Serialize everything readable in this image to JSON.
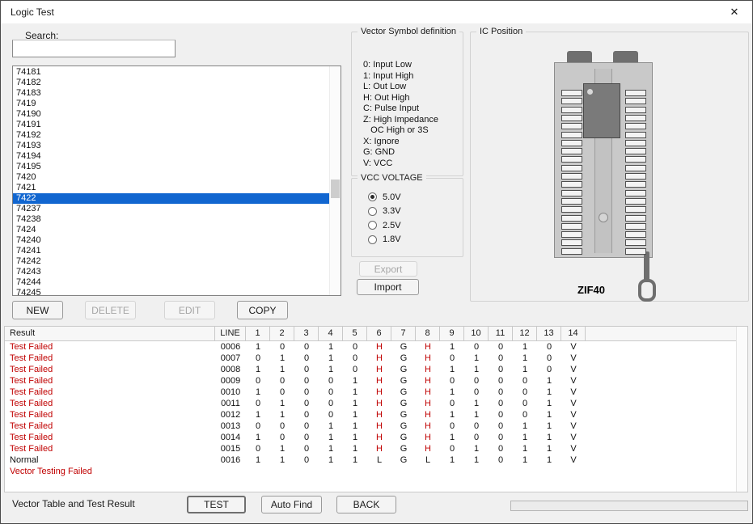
{
  "colors": {
    "selection": "#1166d0",
    "fail_red": "#c00000",
    "window_bg": "#f0f0f0"
  },
  "window": {
    "title": "Logic Test",
    "close_glyph": "✕"
  },
  "search": {
    "label": "Search:",
    "value": ""
  },
  "ic_list": {
    "items": [
      "74181",
      "74182",
      "74183",
      "7419",
      "74190",
      "74191",
      "74192",
      "74193",
      "74194",
      "74195",
      "7420",
      "7421",
      "7422",
      "74237",
      "74238",
      "7424",
      "74240",
      "74241",
      "74242",
      "74243",
      "74244",
      "74245"
    ],
    "selected": "7422"
  },
  "list_actions": {
    "new": "NEW",
    "delete": "DELETE",
    "edit": "EDIT",
    "copy": "COPY"
  },
  "vector_symbols": {
    "title": "Vector Symbol definition",
    "lines": [
      "0: Input Low",
      "1: Input High",
      "L: Out Low",
      "H: Out High",
      "C: Pulse Input",
      "Z: High Impedance",
      "   OC High or 3S",
      "X: Ignore",
      "G: GND",
      "V: VCC"
    ]
  },
  "vcc": {
    "title": "VCC VOLTAGE",
    "options": [
      {
        "label": "5.0V",
        "selected": true
      },
      {
        "label": "3.3V",
        "selected": false
      },
      {
        "label": "2.5V",
        "selected": false
      },
      {
        "label": "1.8V",
        "selected": false
      }
    ]
  },
  "transfer": {
    "export": "Export",
    "import": "Import"
  },
  "ic_position": {
    "title": "IC Position",
    "socket_label": "ZIF40"
  },
  "table": {
    "headers": [
      "Result",
      "LINE",
      "1",
      "2",
      "3",
      "4",
      "5",
      "6",
      "7",
      "8",
      "9",
      "10",
      "11",
      "12",
      "13",
      "14"
    ],
    "fail_symbol": "H",
    "rows": [
      {
        "result": "Test Failed",
        "status": "failed",
        "line": "0006",
        "pins": [
          "1",
          "0",
          "0",
          "1",
          "0",
          "H",
          "G",
          "H",
          "1",
          "0",
          "0",
          "1",
          "0",
          "V"
        ]
      },
      {
        "result": "Test Failed",
        "status": "failed",
        "line": "0007",
        "pins": [
          "0",
          "1",
          "0",
          "1",
          "0",
          "H",
          "G",
          "H",
          "0",
          "1",
          "0",
          "1",
          "0",
          "V"
        ]
      },
      {
        "result": "Test Failed",
        "status": "failed",
        "line": "0008",
        "pins": [
          "1",
          "1",
          "0",
          "1",
          "0",
          "H",
          "G",
          "H",
          "1",
          "1",
          "0",
          "1",
          "0",
          "V"
        ]
      },
      {
        "result": "Test Failed",
        "status": "failed",
        "line": "0009",
        "pins": [
          "0",
          "0",
          "0",
          "0",
          "1",
          "H",
          "G",
          "H",
          "0",
          "0",
          "0",
          "0",
          "1",
          "V"
        ]
      },
      {
        "result": "Test Failed",
        "status": "failed",
        "line": "0010",
        "pins": [
          "1",
          "0",
          "0",
          "0",
          "1",
          "H",
          "G",
          "H",
          "1",
          "0",
          "0",
          "0",
          "1",
          "V"
        ]
      },
      {
        "result": "Test Failed",
        "status": "failed",
        "line": "0011",
        "pins": [
          "0",
          "1",
          "0",
          "0",
          "1",
          "H",
          "G",
          "H",
          "0",
          "1",
          "0",
          "0",
          "1",
          "V"
        ]
      },
      {
        "result": "Test Failed",
        "status": "failed",
        "line": "0012",
        "pins": [
          "1",
          "1",
          "0",
          "0",
          "1",
          "H",
          "G",
          "H",
          "1",
          "1",
          "0",
          "0",
          "1",
          "V"
        ]
      },
      {
        "result": "Test Failed",
        "status": "failed",
        "line": "0013",
        "pins": [
          "0",
          "0",
          "0",
          "1",
          "1",
          "H",
          "G",
          "H",
          "0",
          "0",
          "0",
          "1",
          "1",
          "V"
        ]
      },
      {
        "result": "Test Failed",
        "status": "failed",
        "line": "0014",
        "pins": [
          "1",
          "0",
          "0",
          "1",
          "1",
          "H",
          "G",
          "H",
          "1",
          "0",
          "0",
          "1",
          "1",
          "V"
        ]
      },
      {
        "result": "Test Failed",
        "status": "failed",
        "line": "0015",
        "pins": [
          "0",
          "1",
          "0",
          "1",
          "1",
          "H",
          "G",
          "H",
          "0",
          "1",
          "0",
          "1",
          "1",
          "V"
        ]
      },
      {
        "result": "Normal",
        "status": "normal",
        "line": "0016",
        "pins": [
          "1",
          "1",
          "0",
          "1",
          "1",
          "L",
          "G",
          "L",
          "1",
          "1",
          "0",
          "1",
          "1",
          "V"
        ]
      }
    ],
    "summary": "Vector Testing Failed"
  },
  "bottom": {
    "label": "Vector Table and Test Result",
    "test": "TEST",
    "auto_find": "Auto Find",
    "back": "BACK"
  }
}
